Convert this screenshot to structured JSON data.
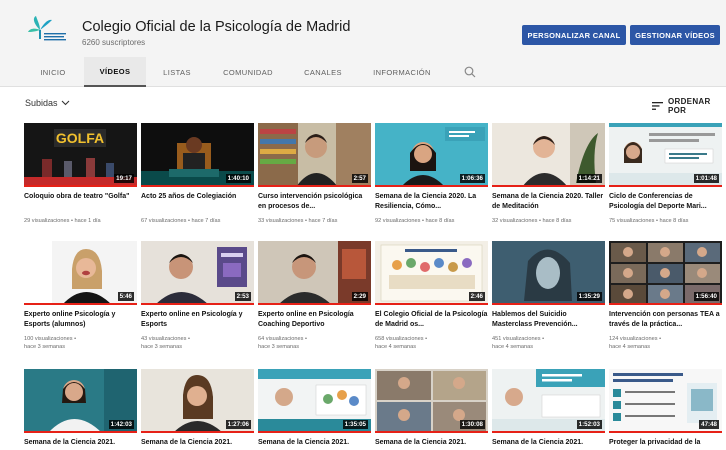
{
  "channel": {
    "name": "Colegio Oficial de la Psicología de Madrid",
    "subscribers": "6260 suscriptores",
    "logo_text": "Colegio Oficial de la Psicología de Madrid"
  },
  "buttons": {
    "customize": "PERSONALIZAR CANAL",
    "manage": "GESTIONAR VÍDEOS"
  },
  "tabs": [
    {
      "label": "INICIO"
    },
    {
      "label": "VÍDEOS"
    },
    {
      "label": "LISTAS"
    },
    {
      "label": "COMUNIDAD"
    },
    {
      "label": "CANALES"
    },
    {
      "label": "INFORMACIÓN"
    }
  ],
  "filter": {
    "label": "Subidas"
  },
  "sort": {
    "label": "ORDENAR POR"
  },
  "colors": {
    "accent": "#2c56a6",
    "progress": "#e62117",
    "header_bg": "#f4f4f4"
  },
  "videos": [
    {
      "title": "Coloquio obra de teatro \"Golfa\"",
      "views": "29 visualizaciones",
      "age": "hace 1 día",
      "duration": "19:17",
      "thumb_text": "GOLFA"
    },
    {
      "title": "Acto 25 años de Colegiación",
      "views": "67 visualizaciones",
      "age": "hace 7 días",
      "duration": "1:40:10",
      "thumb_text": ""
    },
    {
      "title": "Curso intervención psicológica en procesos de...",
      "views": "33 visualizaciones",
      "age": "hace 7 días",
      "duration": "2:57",
      "thumb_text": ""
    },
    {
      "title": "Semana de la Ciencia 2020. La Resiliencia, Cómo...",
      "views": "92 visualizaciones",
      "age": "hace 8 días",
      "duration": "1:06:36",
      "thumb_text": ""
    },
    {
      "title": "Semana de la Ciencia 2020. Taller de Meditación",
      "views": "32 visualizaciones",
      "age": "hace 8 días",
      "duration": "1:14:21",
      "thumb_text": ""
    },
    {
      "title": "Ciclo de Conferencias de Psicología del Deporte Mari...",
      "views": "75 visualizaciones",
      "age": "hace 8 días",
      "duration": "1:01:48",
      "thumb_text": ""
    },
    {
      "title": "Experto online Psicología y Esports (alumnos)",
      "views": "100 visualizaciones",
      "age": "hace 3 semanas",
      "duration": "5:46",
      "thumb_text": ""
    },
    {
      "title": "Experto online en Psicología y Esports",
      "views": "43 visualizaciones",
      "age": "hace 3 semanas",
      "duration": "2:53",
      "thumb_text": ""
    },
    {
      "title": "Experto online en Psicología Coaching Deportivo",
      "views": "64 visualizaciones",
      "age": "hace 3 semanas",
      "duration": "2:29",
      "thumb_text": ""
    },
    {
      "title": "El Colegio Oficial de la Psicología de Madrid os...",
      "views": "658 visualizaciones",
      "age": "hace 4 semanas",
      "duration": "2:46",
      "thumb_text": ""
    },
    {
      "title": "Hablemos del Suicidio Masterclass Prevención...",
      "views": "451 visualizaciones",
      "age": "hace 4 semanas",
      "duration": "1:35:29",
      "thumb_text": ""
    },
    {
      "title": "Intervención con personas TEA a través de la práctica...",
      "views": "124 visualizaciones",
      "age": "hace 4 semanas",
      "duration": "1:56:40",
      "thumb_text": ""
    },
    {
      "title": "Semana de la Ciencia 2021.",
      "views": "",
      "age": "",
      "duration": "1:42:03",
      "thumb_text": ""
    },
    {
      "title": "Semana de la Ciencia 2021.",
      "views": "",
      "age": "",
      "duration": "1:27:06",
      "thumb_text": ""
    },
    {
      "title": "Semana de la Ciencia 2021.",
      "views": "",
      "age": "",
      "duration": "1:35:05",
      "thumb_text": ""
    },
    {
      "title": "Semana de la Ciencia 2021.",
      "views": "",
      "age": "",
      "duration": "1:30:08",
      "thumb_text": ""
    },
    {
      "title": "Semana de la Ciencia 2021.",
      "views": "",
      "age": "",
      "duration": "1:52:03",
      "thumb_text": ""
    },
    {
      "title": "Proteger la privacidad de la",
      "views": "",
      "age": "",
      "duration": "47:48",
      "thumb_text": ""
    }
  ]
}
